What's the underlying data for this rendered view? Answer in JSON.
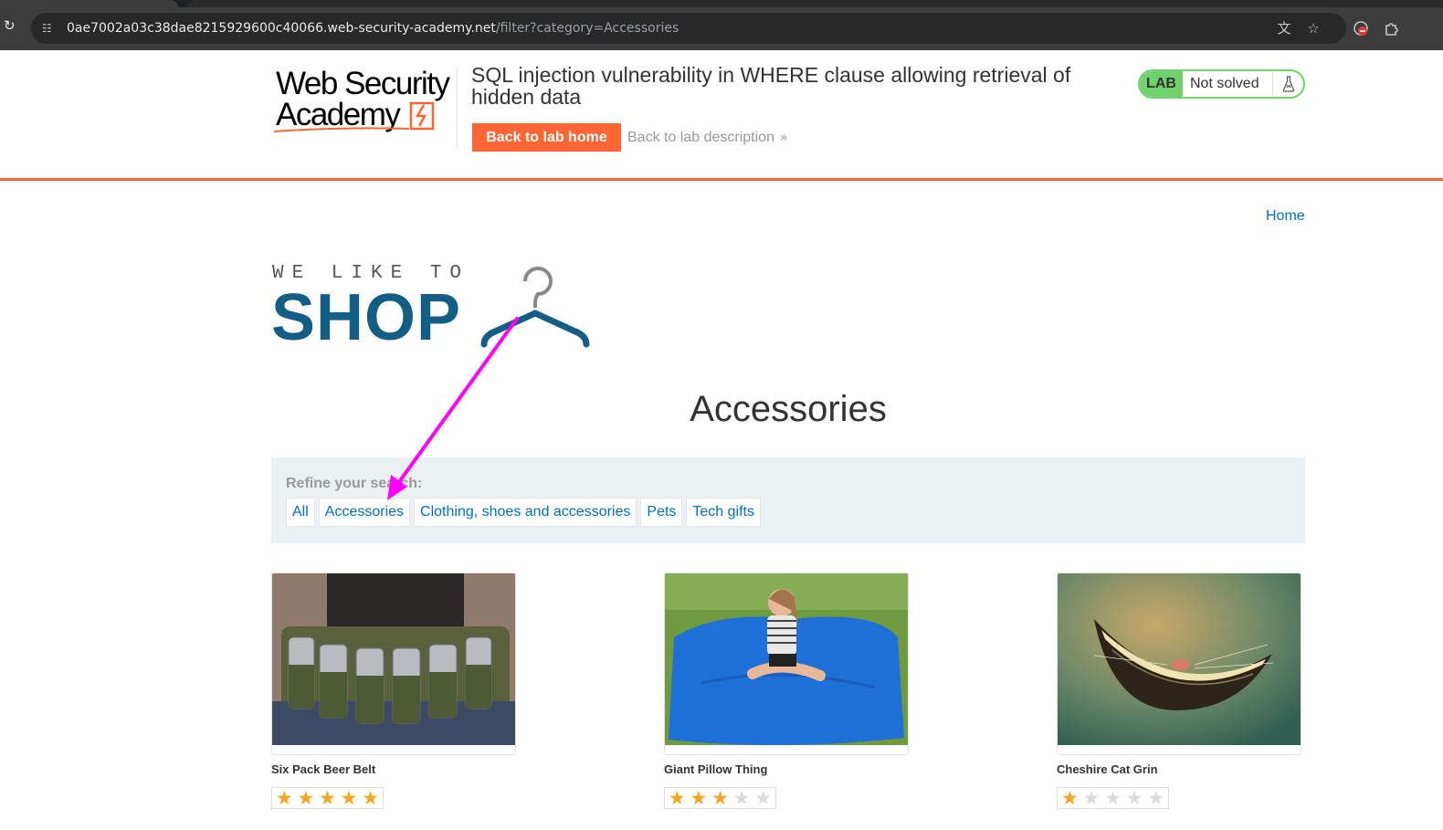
{
  "browser": {
    "url_host": "0ae7002a03c38dae8215929600c40066.web-security-academy.net",
    "url_path": "/filter?category=Accessories",
    "icons": [
      "reload-icon",
      "site-info-icon",
      "translate-icon",
      "bookmark-star-icon",
      "extension-icon",
      "puzzle-icon"
    ]
  },
  "lab": {
    "logo_line1": "Web Security",
    "logo_line2": "Academy",
    "title": "SQL injection vulnerability in WHERE clause allowing retrieval of hidden data",
    "back_home_label": "Back to lab home",
    "back_description_label": "Back to lab description",
    "status_tag": "LAB",
    "status_text": "Not solved"
  },
  "shop": {
    "nav_home": "Home",
    "logo_tagline": "WE LIKE TO",
    "logo_word": "SHOP",
    "category_heading": "Accessories",
    "refine_label": "Refine your search:",
    "filters": [
      "All",
      "Accessories",
      "Clothing, shoes and accessories",
      "Pets",
      "Tech gifts"
    ],
    "products": [
      {
        "name": "Six Pack Beer Belt",
        "rating": 5
      },
      {
        "name": "Giant Pillow Thing",
        "rating": 3
      },
      {
        "name": "Cheshire Cat Grin",
        "rating": 1
      }
    ]
  },
  "colors": {
    "accent": "#ff6633",
    "link": "#0071bc",
    "shop_logo": "#145d85",
    "lab_green": "#70d16d",
    "annotation_arrow": "#ff00ff"
  }
}
